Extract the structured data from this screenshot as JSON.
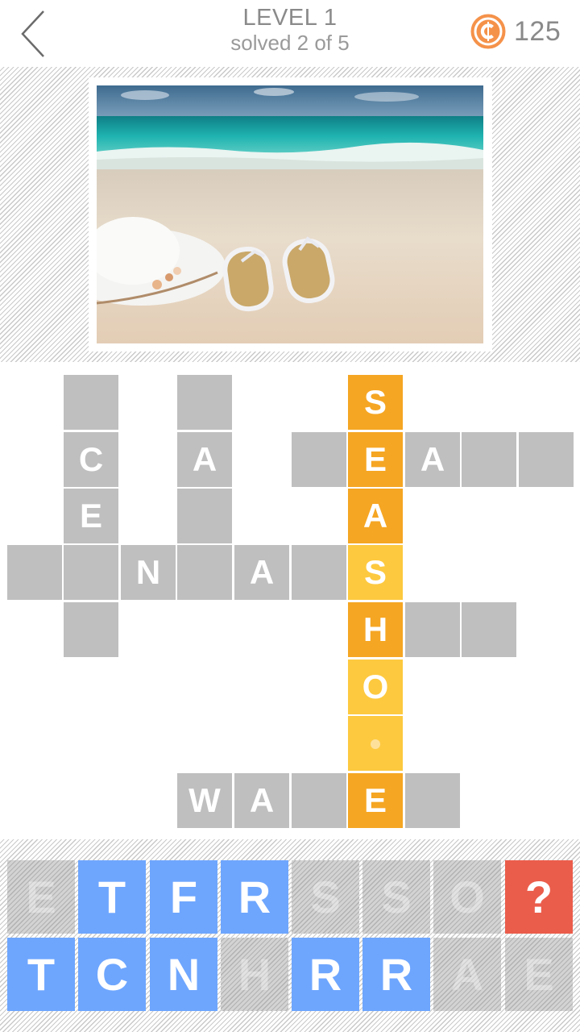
{
  "header": {
    "back_icon": "chevron-left-icon",
    "level_title": "LEVEL 1",
    "progress_text": "solved 2 of 5",
    "coin_icon": "coin-icon",
    "coin_count": "125",
    "coin_color": "#f5924a"
  },
  "puzzle_image": {
    "description": "Beach scene with turquoise sea, white sun hat and straw flip-flops on sand"
  },
  "colors": {
    "empty_cell": "#bfbfbf",
    "answer_orange": "#f5a623",
    "answer_yellow": "#fdc93f",
    "bank_active": "#6ea6fe",
    "bank_hint": "#eb5d4b"
  },
  "crossword": {
    "cells": [
      {
        "col": 1,
        "row": 0,
        "letter": "",
        "style": "gray"
      },
      {
        "col": 3,
        "row": 0,
        "letter": "",
        "style": "gray"
      },
      {
        "col": 6,
        "row": 0,
        "letter": "S",
        "style": "orange"
      },
      {
        "col": 1,
        "row": 1,
        "letter": "C",
        "style": "gray"
      },
      {
        "col": 3,
        "row": 1,
        "letter": "A",
        "style": "gray"
      },
      {
        "col": 5,
        "row": 1,
        "letter": "",
        "style": "gray"
      },
      {
        "col": 6,
        "row": 1,
        "letter": "E",
        "style": "orange"
      },
      {
        "col": 7,
        "row": 1,
        "letter": "A",
        "style": "gray"
      },
      {
        "col": 8,
        "row": 1,
        "letter": "",
        "style": "gray"
      },
      {
        "col": 9,
        "row": 1,
        "letter": "",
        "style": "gray"
      },
      {
        "col": 1,
        "row": 2,
        "letter": "E",
        "style": "gray"
      },
      {
        "col": 3,
        "row": 2,
        "letter": "",
        "style": "gray"
      },
      {
        "col": 6,
        "row": 2,
        "letter": "A",
        "style": "orange"
      },
      {
        "col": 0,
        "row": 3,
        "letter": "",
        "style": "gray"
      },
      {
        "col": 1,
        "row": 3,
        "letter": "",
        "style": "gray"
      },
      {
        "col": 2,
        "row": 3,
        "letter": "N",
        "style": "gray"
      },
      {
        "col": 3,
        "row": 3,
        "letter": "",
        "style": "gray"
      },
      {
        "col": 4,
        "row": 3,
        "letter": "A",
        "style": "gray"
      },
      {
        "col": 5,
        "row": 3,
        "letter": "",
        "style": "gray"
      },
      {
        "col": 6,
        "row": 3,
        "letter": "S",
        "style": "yellow"
      },
      {
        "col": 1,
        "row": 4,
        "letter": "",
        "style": "gray"
      },
      {
        "col": 6,
        "row": 4,
        "letter": "H",
        "style": "orange"
      },
      {
        "col": 7,
        "row": 4,
        "letter": "",
        "style": "gray"
      },
      {
        "col": 8,
        "row": 4,
        "letter": "",
        "style": "gray"
      },
      {
        "col": 6,
        "row": 5,
        "letter": "O",
        "style": "yellow"
      },
      {
        "col": 6,
        "row": 6,
        "letter": "",
        "style": "yellow",
        "cursor": true
      },
      {
        "col": 3,
        "row": 7,
        "letter": "W",
        "style": "gray"
      },
      {
        "col": 4,
        "row": 7,
        "letter": "A",
        "style": "gray"
      },
      {
        "col": 5,
        "row": 7,
        "letter": "",
        "style": "gray"
      },
      {
        "col": 6,
        "row": 7,
        "letter": "E",
        "style": "orange"
      },
      {
        "col": 7,
        "row": 7,
        "letter": "",
        "style": "gray"
      }
    ]
  },
  "letter_bank": {
    "rows": [
      [
        {
          "letter": "E",
          "state": "used"
        },
        {
          "letter": "T",
          "state": "active"
        },
        {
          "letter": "F",
          "state": "active"
        },
        {
          "letter": "R",
          "state": "active"
        },
        {
          "letter": "S",
          "state": "used"
        },
        {
          "letter": "S",
          "state": "used"
        },
        {
          "letter": "O",
          "state": "used"
        },
        {
          "letter": "?",
          "state": "hint"
        }
      ],
      [
        {
          "letter": "T",
          "state": "active"
        },
        {
          "letter": "C",
          "state": "active"
        },
        {
          "letter": "N",
          "state": "active"
        },
        {
          "letter": "H",
          "state": "used"
        },
        {
          "letter": "R",
          "state": "active"
        },
        {
          "letter": "R",
          "state": "active"
        },
        {
          "letter": "A",
          "state": "used"
        },
        {
          "letter": "E",
          "state": "used"
        }
      ]
    ]
  }
}
